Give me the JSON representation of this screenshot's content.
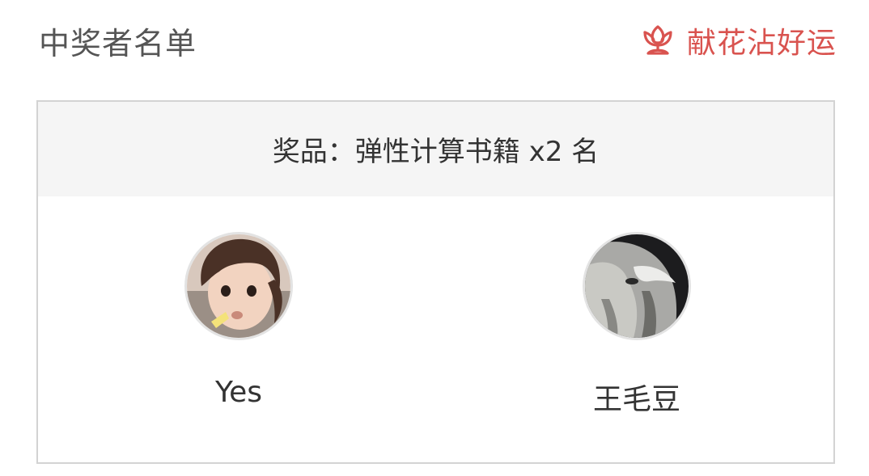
{
  "header": {
    "title": "中奖者名单",
    "action_label": "献花沾好运",
    "action_icon": "flower-icon",
    "accent_color": "#d9534f"
  },
  "prize": {
    "text": "奖品：弹性计算书籍 x2 名"
  },
  "winners": [
    {
      "name": "Yes",
      "avatar": "child-photo-avatar"
    },
    {
      "name": "王毛豆",
      "avatar": "cat-photo-avatar"
    }
  ]
}
